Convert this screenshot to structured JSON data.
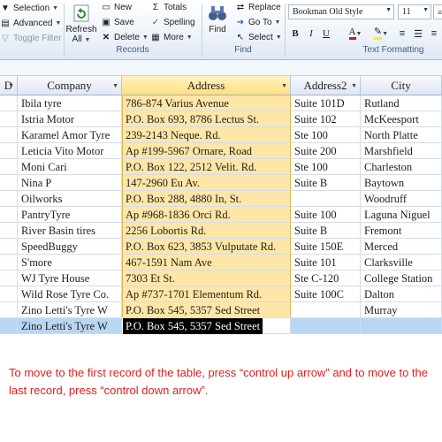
{
  "ribbon": {
    "selection": "Selection",
    "advanced": "Advanced",
    "toggle_filter": "Toggle Filter",
    "refresh": "Refresh All",
    "refresh_line1": "Refresh",
    "refresh_line2": "All",
    "new": "New",
    "save": "Save",
    "delete": "Delete",
    "totals": "Totals",
    "spelling": "Spelling",
    "more": "More",
    "records_group": "Records",
    "find": "Find",
    "replace": "Replace",
    "goto": "Go To",
    "select": "Select",
    "find_group": "Find",
    "font_name": "Bookman Old Style",
    "font_size": "11",
    "bold": "B",
    "italic": "I",
    "underline": "U",
    "text_formatting_group": "Text Formatting",
    "font_color": "#cc1a1a",
    "highlight_color": "#ffee00"
  },
  "table": {
    "columns": [
      "D",
      "Company",
      "Address",
      "Address2",
      "City"
    ],
    "rows": [
      [
        "",
        "Ibila tyre",
        "786-874 Varius Avenue",
        "Suite 101D",
        "Rutland"
      ],
      [
        "",
        "Istria Motor",
        "P.O. Box 693, 8786 Lectus St.",
        "Suite 102",
        "McKeesport"
      ],
      [
        "",
        "Karamel Amor Tyre",
        "239-2143 Neque. Rd.",
        "Ste 100",
        "North Platte"
      ],
      [
        "",
        "Leticia Vito Motor",
        "Ap #199-5967 Ornare, Road",
        "Suite 200",
        "Marshfield"
      ],
      [
        "",
        "Moni Cari",
        "P.O. Box 122, 2512 Velit. Rd.",
        "Ste 100",
        "Charleston"
      ],
      [
        "",
        "Nina P",
        "147-2960 Eu Av.",
        "Suite B",
        "Baytown"
      ],
      [
        "",
        "Oilworks",
        "P.O. Box 288, 4880 In, St.",
        "",
        "Woodruff"
      ],
      [
        "",
        "PantryTyre",
        "Ap #968-1836 Orci Rd.",
        "Suite 100",
        "Laguna Niguel"
      ],
      [
        "",
        "River Basin tires",
        "2256 Lobortis Rd.",
        "Suite B",
        "Fremont"
      ],
      [
        "",
        "SpeedBuggy",
        "P.O. Box 623, 3853 Vulputate Rd.",
        "Suite 150E",
        "Merced"
      ],
      [
        "",
        "S'more",
        "467-1591 Nam Ave",
        "Suite 101",
        "Clarksville"
      ],
      [
        "",
        "WJ Tyre House",
        "7303 Et St.",
        "Ste C-120",
        "College Station"
      ],
      [
        "",
        "Wild Rose Tyre Co.",
        "Ap #737-1701 Elementum Rd.",
        "Suite 100C",
        "Dalton"
      ],
      [
        "",
        "Zino Letti's Tyre W",
        "P.O. Box 545, 5357 Sed Street",
        "",
        "Murray"
      ]
    ],
    "new_row": {
      "company": "Zino Letti's Tyre W",
      "address": "P.O. Box 545, 5357 Sed Street"
    }
  },
  "caption": "To move to the first record of the table, press “control up arrow” and to move to the last record, press “control down arrow”.",
  "colors": {
    "caption": "#e31b1b",
    "selected_column": "#fde6a8",
    "new_row": "#b9d6f3"
  }
}
